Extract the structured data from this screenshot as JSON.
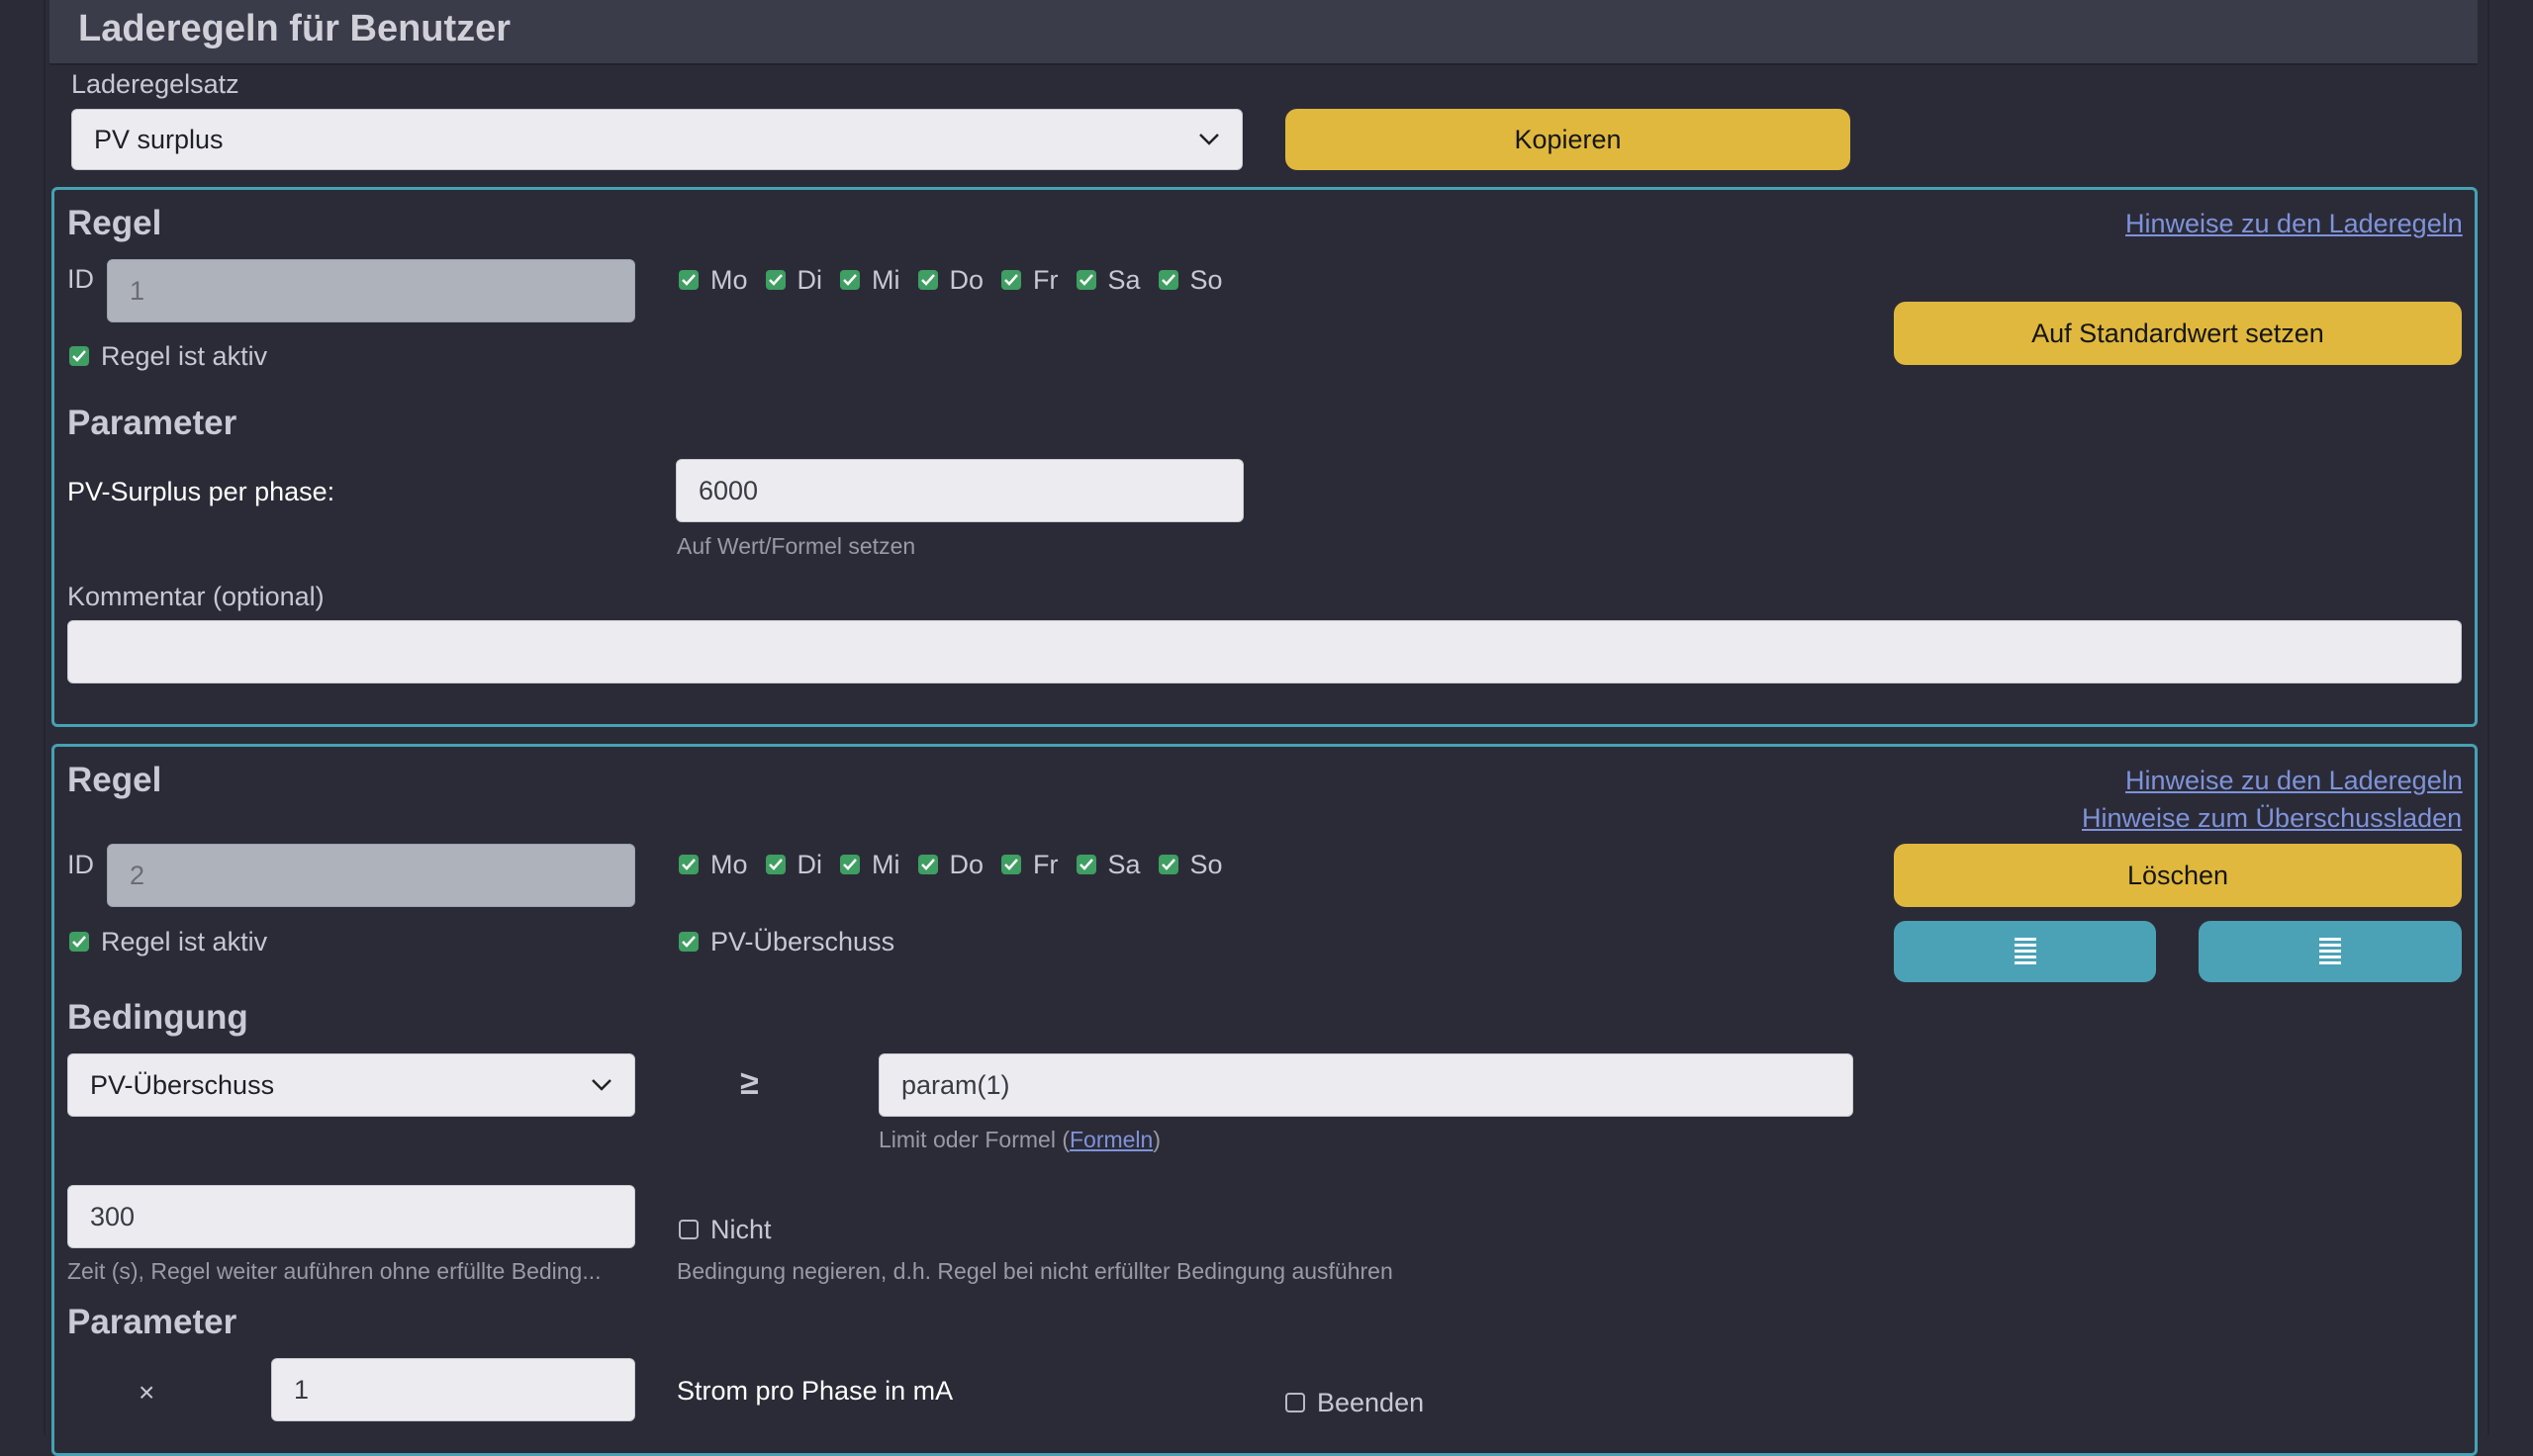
{
  "header": {
    "title": "Laderegeln für Benutzer"
  },
  "ruleset": {
    "label": "Laderegelsatz",
    "value": "PV surplus",
    "copy_label": "Kopieren"
  },
  "rule1": {
    "title": "Regel",
    "hint_link": "Hinweise zu den Laderegeln",
    "id_label": "ID",
    "id_value": "1",
    "days": [
      "Mo",
      "Di",
      "Mi",
      "Do",
      "Fr",
      "Sa",
      "So"
    ],
    "active_label": "Regel ist aktiv",
    "default_button": "Auf Standardwert setzen",
    "param_title": "Parameter",
    "param_label": "PV-Surplus per phase:",
    "param_value": "6000",
    "param_hint": "Auf Wert/Formel setzen",
    "comment_label": "Kommentar (optional)",
    "comment_value": ""
  },
  "rule2": {
    "title": "Regel",
    "hint_link": "Hinweise zu den Laderegeln",
    "surplus_link": "Hinweise zum Überschussladen",
    "id_label": "ID",
    "id_value": "2",
    "days": [
      "Mo",
      "Di",
      "Mi",
      "Do",
      "Fr",
      "Sa",
      "So"
    ],
    "active_label": "Regel ist aktiv",
    "pv_label": "PV-Überschuss",
    "delete_button": "Löschen",
    "condition_title": "Bedingung",
    "condition_select": "PV-Überschuss",
    "operator": "≥",
    "condition_value": "param(1)",
    "condition_hint_prefix": "Limit oder Formel (",
    "condition_hint_link": "Formeln",
    "condition_hint_suffix": ")",
    "time_value": "300",
    "time_hint": "Zeit (s), Regel weiter auführen ohne erfüllte Beding...",
    "not_label": "Nicht",
    "not_hint": "Bedingung negieren, d.h. Regel bei nicht erfüllter Bedingung ausführen",
    "param_title": "Parameter",
    "multiplier": "×",
    "param_value": "1",
    "param_label": "Strom pro Phase in mA",
    "stop_label": "Beenden"
  }
}
